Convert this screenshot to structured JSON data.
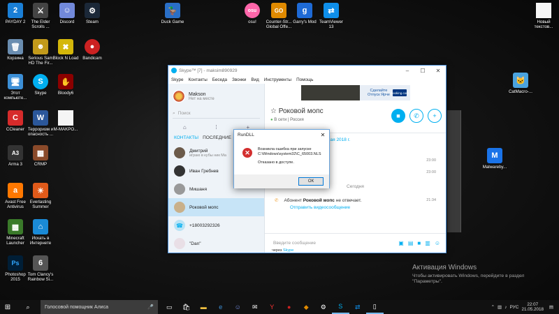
{
  "desktop": {
    "icons": [
      {
        "label": "PAYDAY 2",
        "icon": "payday-icon",
        "color": "#1a7fd6",
        "glyph": "2"
      },
      {
        "label": "The Elder\nScrolls ...",
        "icon": "skyrim-icon",
        "color": "#444",
        "glyph": "⚔"
      },
      {
        "label": "Discord",
        "icon": "discord-icon",
        "color": "#7289da",
        "glyph": "☺"
      },
      {
        "label": "Steam",
        "icon": "steam-icon",
        "color": "#1b2838",
        "glyph": "⚙"
      },
      {
        "label": "Duck Game",
        "icon": "duck-game-icon",
        "color": "#2a6fc7",
        "glyph": "🦆"
      },
      {
        "label": "osu!",
        "icon": "osu-icon",
        "color": "#ff66aa",
        "glyph": "osu"
      },
      {
        "label": "Counter-Str...\nGlobal Offe...",
        "icon": "csgo-icon",
        "color": "#e08a00",
        "glyph": "GO"
      },
      {
        "label": "Garry's Mod",
        "icon": "gmod-icon",
        "color": "#1e6ad6",
        "glyph": "g"
      },
      {
        "label": "TeamViewer\n13",
        "icon": "teamviewer-icon",
        "color": "#0e8ee9",
        "glyph": "⇄"
      },
      {
        "label": "Новый\nтекстов...",
        "icon": "text-file-icon",
        "color": "#f5f5f5",
        "glyph": ""
      },
      {
        "label": "Корзина",
        "icon": "recycle-bin-icon",
        "color": "#6a8db0",
        "glyph": "🗑"
      },
      {
        "label": "Serious Sam\nHD The Fir...",
        "icon": "serious-sam-icon",
        "color": "#c29a1b",
        "glyph": "☻"
      },
      {
        "label": "Block N Load",
        "icon": "block-n-load-icon",
        "color": "#d4b70a",
        "glyph": "✖"
      },
      {
        "label": "Bandicam",
        "icon": "bandicam-icon",
        "color": "#cc2222",
        "glyph": "●"
      },
      {
        "label": "CatMacro-...",
        "icon": "catmacro-icon",
        "color": "#4aa3df",
        "glyph": "🐱"
      },
      {
        "label": "Этот\nкомпьюте...",
        "icon": "this-pc-icon",
        "color": "#3c8fd6",
        "glyph": "🖥"
      },
      {
        "label": "Skype",
        "icon": "skype-icon",
        "color": "#00aff0",
        "glyph": "S"
      },
      {
        "label": "Bloody6",
        "icon": "bloody-icon",
        "color": "#8b0000",
        "glyph": "✋"
      },
      {
        "label": "CCleaner",
        "icon": "ccleaner-icon",
        "color": "#d62b2b",
        "glyph": "C"
      },
      {
        "label": "Терроризм и\nопасность ...",
        "icon": "word-doc-icon",
        "color": "#2b579a",
        "glyph": "W"
      },
      {
        "label": "M-MAKPO...",
        "icon": "blank-file-icon",
        "color": "#f5f5f5",
        "glyph": ""
      },
      {
        "label": "Malwareby...",
        "icon": "malwarebytes-icon",
        "color": "#1a73e8",
        "glyph": "M"
      },
      {
        "label": "Arma 3",
        "icon": "arma-icon",
        "color": "#333",
        "glyph": "A3"
      },
      {
        "label": "CRMP",
        "icon": "crmp-icon",
        "color": "#8a4a2a",
        "glyph": "▦"
      },
      {
        "label": "Avast Free\nAntivirus",
        "icon": "avast-icon",
        "color": "#ff7800",
        "glyph": "a"
      },
      {
        "label": "Everlasting\nSummer",
        "icon": "everlasting-summer-icon",
        "color": "#e05a1a",
        "glyph": "☀"
      },
      {
        "label": "Minecraft\nLauncher",
        "icon": "minecraft-icon",
        "color": "#3a7a2a",
        "glyph": "▩"
      },
      {
        "label": "Искать в\nИнтернете",
        "icon": "search-web-icon",
        "color": "#1a8ad6",
        "glyph": "⌂"
      },
      {
        "label": "Photoshop\n2015",
        "icon": "photoshop-icon",
        "color": "#001e36",
        "glyph": "Ps"
      },
      {
        "label": "Tom Clancy's\nRainbow Si...",
        "icon": "rainbow-six-icon",
        "color": "#555",
        "glyph": "6"
      }
    ]
  },
  "skype": {
    "title": "Skype™ [7] - maksim890929",
    "menu": [
      "Skype",
      "Контакты",
      "Беседа",
      "Звонки",
      "Вид",
      "Инструменты",
      "Помощь"
    ],
    "profile": {
      "name": "Makson",
      "status": "Нет на месте"
    },
    "search_placeholder": "Поиск",
    "tabs": {
      "contacts": "КОНТАКТЫ",
      "recent": "ПОСЛЕДНИЕ"
    },
    "contacts": [
      {
        "name": "Дмитрий",
        "status": "играю в кубы ник Ма"
      },
      {
        "name": "Иван Гребнев",
        "status": ""
      },
      {
        "name": "Мишаня",
        "status": ""
      },
      {
        "name": "Роковой мопс",
        "status": ""
      },
      {
        "name": "+18003292326",
        "status": ""
      },
      {
        "name": "\"Dan\"",
        "status": ""
      }
    ],
    "ad": {
      "text": "Сделайте Отпуск Ярче",
      "button": "Booking.com"
    },
    "chat": {
      "name": "Роковой мопс",
      "status": "В сети  |  Россия",
      "date": "12 мая 2018 г.",
      "times": [
        "23:00",
        "23:00"
      ],
      "today": "Сегодня",
      "missed_prefix": "Абонент ",
      "missed_name": "Роковой мопс",
      "missed_suffix": " не отвечает.",
      "missed_time": "21:34",
      "video_link": "Отправить видеосообщение",
      "via_prefix": "через ",
      "via_link": "Skype",
      "input_placeholder": "Введите сообщение"
    }
  },
  "dialog": {
    "title": "RunDLL",
    "message_line1": "Возникла ошибка при запуске",
    "message_line2": "C:\\Windows\\system32\\C_65003.NLS",
    "message_line3": "Отказано в доступе.",
    "ok_label": "ОК"
  },
  "activation": {
    "title": "Активация Windows",
    "line1": "Чтобы активировать Windows, перейдите в раздел",
    "line2": "\"Параметры\"."
  },
  "taskbar": {
    "assistant": "Голосовой помощник Алиса",
    "language": "РУС",
    "time": "22:07",
    "date": "21.05.2018"
  }
}
